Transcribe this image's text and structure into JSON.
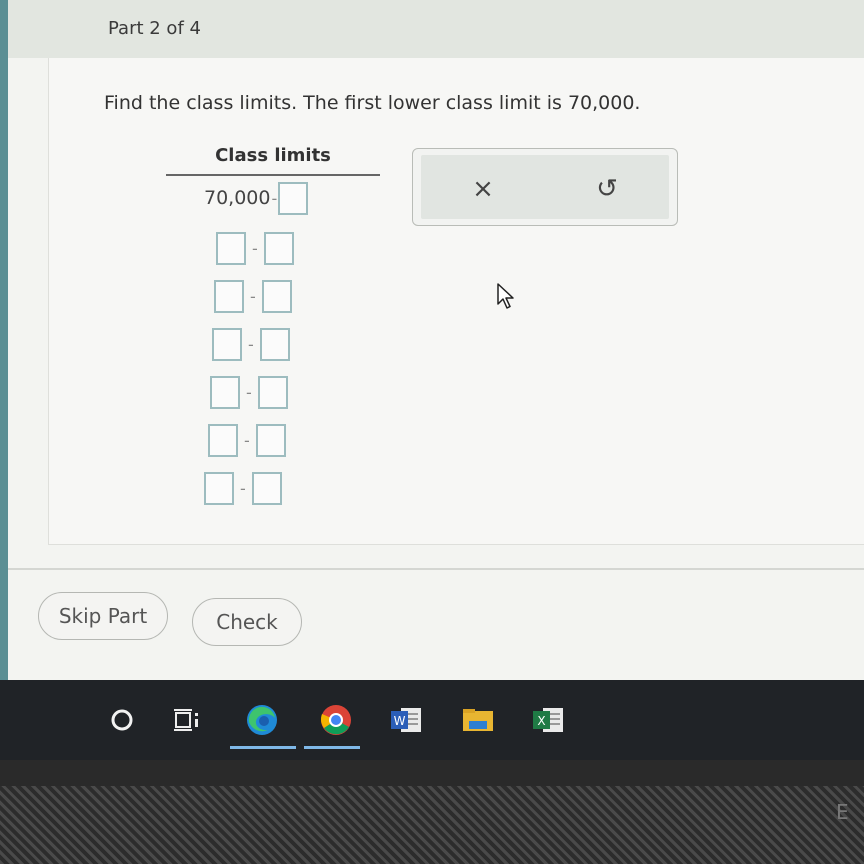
{
  "header": {
    "part_label": "Part 2 of 4"
  },
  "question": {
    "text": "Find the class limits. The first lower class limit is 70,000."
  },
  "table": {
    "heading": "Class limits",
    "first_lower": "70,000",
    "dash": "-"
  },
  "tools": {
    "clear_icon": "×",
    "undo_icon": "↺"
  },
  "buttons": {
    "skip_label": "Skip Part",
    "check_label": "Check"
  },
  "edge_letter": "E"
}
